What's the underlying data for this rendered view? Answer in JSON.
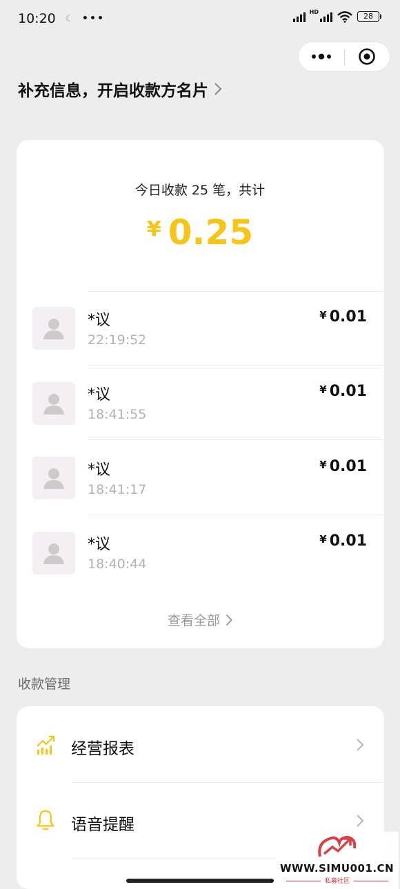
{
  "status_bar": {
    "time": "10:20",
    "battery": "28"
  },
  "header": {
    "title": "补充信息，开启收款方名片"
  },
  "summary": {
    "label": "今日收款 25 笔，共计",
    "currency": "¥",
    "amount": "0.25"
  },
  "transactions": [
    {
      "name": "*议",
      "time": "22:19:52",
      "currency": "¥",
      "amount": "0.01"
    },
    {
      "name": "*议",
      "time": "18:41:55",
      "currency": "¥",
      "amount": "0.01"
    },
    {
      "name": "*议",
      "time": "18:41:17",
      "currency": "¥",
      "amount": "0.01"
    },
    {
      "name": "*议",
      "time": "18:40:44",
      "currency": "¥",
      "amount": "0.01"
    }
  ],
  "view_all": "查看全部",
  "section_title": "收款管理",
  "manage_items": [
    {
      "label": "经营报表",
      "icon": "chart-up-icon"
    },
    {
      "label": "语音提醒",
      "icon": "bell-icon"
    }
  ],
  "watermark": {
    "url": "WWW.SIMU001.CN",
    "sub": "私募社区"
  },
  "colors": {
    "accent": "#f5c518",
    "background": "#ededed",
    "card": "#ffffff",
    "muted": "#b2b2b2"
  }
}
